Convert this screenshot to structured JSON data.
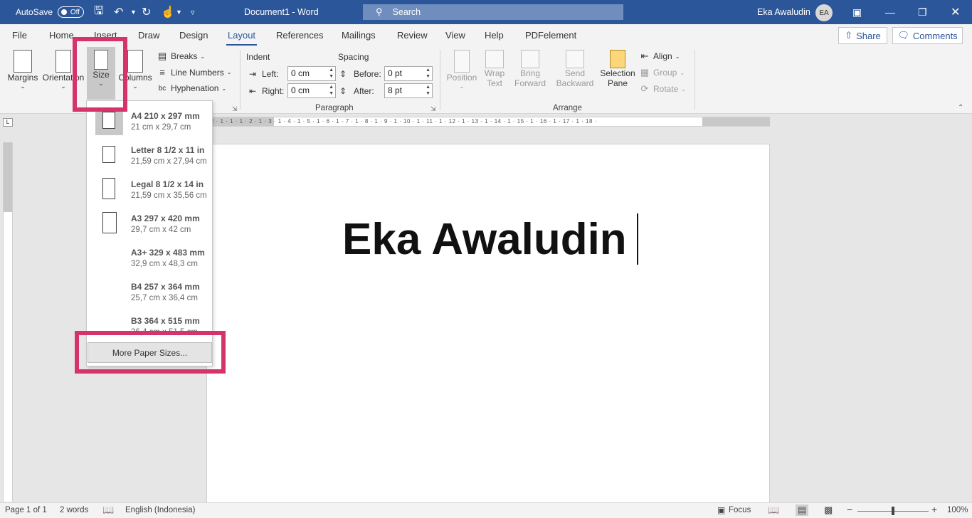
{
  "titlebar": {
    "autosave_label": "AutoSave",
    "autosave_state": "Off",
    "doc_title": "Document1  -  Word",
    "search_placeholder": "Search",
    "user_name": "Eka Awaludin",
    "user_initials": "EA"
  },
  "tabs": [
    "File",
    "Home",
    "Insert",
    "Draw",
    "Design",
    "Layout",
    "References",
    "Mailings",
    "Review",
    "View",
    "Help",
    "PDFelement"
  ],
  "active_tab": "Layout",
  "share_label": "Share",
  "comments_label": "Comments",
  "ribbon": {
    "page_setup": {
      "margins": "Margins",
      "orientation": "Orientation",
      "size": "Size",
      "columns": "Columns",
      "breaks": "Breaks",
      "line_numbers": "Line Numbers",
      "hyphenation": "Hyphenation"
    },
    "paragraph": {
      "indent_label": "Indent",
      "spacing_label": "Spacing",
      "left_label": "Left:",
      "left_value": "0 cm",
      "right_label": "Right:",
      "right_value": "0 cm",
      "before_label": "Before:",
      "before_value": "0 pt",
      "after_label": "After:",
      "after_value": "8 pt",
      "group_label": "Paragraph"
    },
    "arrange": {
      "position": "Position",
      "wrap_text_1": "Wrap",
      "wrap_text_2": "Text",
      "bring_forward_1": "Bring",
      "bring_forward_2": "Forward",
      "send_backward_1": "Send",
      "send_backward_2": "Backward",
      "selection_pane_1": "Selection",
      "selection_pane_2": "Pane",
      "align": "Align",
      "group": "Group",
      "rotate": "Rotate",
      "group_label": "Arrange"
    }
  },
  "size_menu": {
    "items": [
      {
        "name": "A4 210 x 297 mm",
        "dims": "21 cm x 29,7 cm"
      },
      {
        "name": "Letter 8 1/2 x 11 in",
        "dims": "21,59 cm x 27,94 cm"
      },
      {
        "name": "Legal 8 1/2 x 14 in",
        "dims": "21,59 cm x 35,56 cm"
      },
      {
        "name": "A3 297 x 420 mm",
        "dims": "29,7 cm x 42 cm"
      },
      {
        "name": "A3+ 329 x 483 mm",
        "dims": "32,9 cm x 48,3 cm"
      },
      {
        "name": "B4 257 x 364 mm",
        "dims": "25,7 cm x 36,4 cm"
      },
      {
        "name": "B3 364 x 515 mm",
        "dims": "36,4 cm x 51,5 cm"
      }
    ],
    "selected": "A4 210 x 297 mm",
    "more_label": "More Paper Sizes..."
  },
  "ruler_numbers": "· 2 · 1 · 1 · 1 · 2 · 1 · 3 · 1 · 4 · 1 · 5 · 1 · 6 · 1 · 7 · 1 · 8 · 1 · 9 · 1 · 10 · 1 · 11 · 1 · 12 · 1 · 13 · 1 · 14 · 1 · 15 · 1 · 16 · 1 · 17 · 1 · 18 ·",
  "document": {
    "text": "Eka Awaludin"
  },
  "statusbar": {
    "page": "Page 1 of 1",
    "words": "2 words",
    "language": "English (Indonesia)",
    "focus": "Focus",
    "zoom": "100%"
  },
  "colors": {
    "title_bar": "#2b579a",
    "highlight": "#d6336c"
  }
}
